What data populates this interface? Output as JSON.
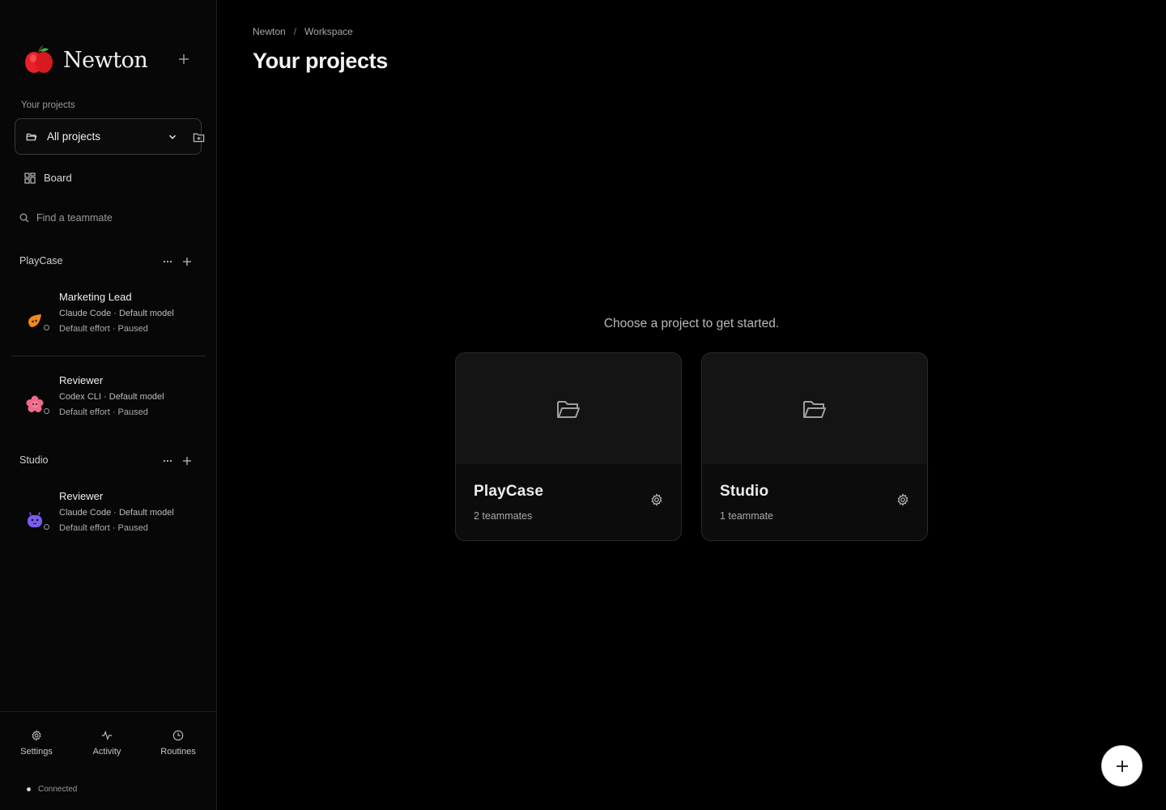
{
  "brand": {
    "name": "Newton"
  },
  "sidebar": {
    "section_caption": "Your projects",
    "project_select": {
      "value": "All projects"
    },
    "board_label": "Board",
    "search": {
      "placeholder": "Find a teammate"
    },
    "groups": [
      {
        "name": "PlayCase",
        "teammates": [
          {
            "name": "Marketing Lead",
            "line1": "Claude Code · Default model",
            "line2": "Default effort · Paused",
            "avatar": "orange-leaf-avatar"
          },
          {
            "name": "Reviewer",
            "line1": "Codex CLI · Default model",
            "line2": "Default effort · Paused",
            "avatar": "pink-flower-avatar"
          }
        ]
      },
      {
        "name": "Studio",
        "teammates": [
          {
            "name": "Reviewer",
            "line1": "Claude Code · Default model",
            "line2": "Default effort · Paused",
            "avatar": "purple-robot-avatar"
          }
        ]
      }
    ],
    "footer": {
      "settings": "Settings",
      "activity": "Activity",
      "routines": "Routines",
      "status": "Connected"
    }
  },
  "main": {
    "breadcrumb": [
      "Newton",
      "Workspace"
    ],
    "title": "Your projects",
    "prompt": "Choose a project to get started.",
    "projects": [
      {
        "name": "PlayCase",
        "count": "2 teammates"
      },
      {
        "name": "Studio",
        "count": "1 teammate"
      }
    ]
  },
  "colors": {
    "background": "#000000",
    "sidebar": "#070707",
    "card": "#0c0c0c",
    "accent_orange": "#f08a1c",
    "accent_pink": "#f06a8a",
    "accent_purple": "#7c5cf0"
  }
}
